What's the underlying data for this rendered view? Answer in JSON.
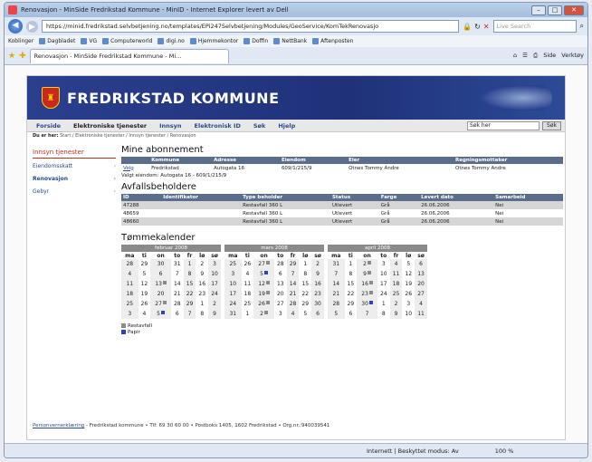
{
  "browser": {
    "window_title": "Renovasjon - MinSide Fredrikstad Kommune - MinID - Internet Explorer levert av Dell",
    "url": "https://minid.fredrikstad.selvbetjening.no/templates/EPi247Selvbetjening/Modules/GeoService/KomTekRenovasjo",
    "search_placeholder": "Live Search",
    "links_label": "Koblinger",
    "favorites": [
      "Dagbladet",
      "VG",
      "Computerworld",
      "digi.no",
      "Hjemmekontor",
      "Doffin",
      "NettBank",
      "Aftenposten"
    ],
    "tab_title": "Renovasjon - MinSide Fredrikstad Kommune - Mi...",
    "tools": [
      "Side",
      "Verktøy"
    ],
    "status_zone": "Internett | Beskyttet modus: Av",
    "zoom": "100 %"
  },
  "site": {
    "title": "FREDRIKSTAD KOMMUNE",
    "nav": [
      "Forside",
      "Elektroniske tjenester",
      "Innsyn",
      "Elektronisk ID",
      "Søk",
      "Hjelp"
    ],
    "search_value": "Søk her",
    "search_button": "Søk",
    "breadcrumb_label": "Du er her:",
    "breadcrumb": "Start / Elektroniske tjenester / Innsyn tjenester / Renovasjon"
  },
  "leftnav": {
    "heading": "Innsyn tjenester",
    "items": [
      "Eiendomsskatt",
      "Renovasjon",
      "Gebyr"
    ]
  },
  "abonnement": {
    "title": "Mine abonnement",
    "headers": [
      "",
      "Kommune",
      "Adresse",
      "Eiendom",
      "Eier",
      "Regningsmottaker"
    ],
    "row": [
      "Velg",
      "Fredrikstad",
      "Autogata 16",
      "609/1/215/9",
      "Otnes Tommy Andre",
      "Otnes Tommy Andre"
    ],
    "selected": "Valgt eiendom: Autogata 16 - 609/1/215/9"
  },
  "avfall": {
    "title": "Avfallsbeholdere",
    "headers": [
      "ID",
      "Identifikator",
      "Type beholder",
      "Status",
      "Farge",
      "Levert dato",
      "Samarbeid"
    ],
    "rows": [
      [
        "47288",
        "",
        "Restavfall 360 L",
        "Utlevert",
        "Grå",
        "26.06.2006",
        "Nei"
      ],
      [
        "48659",
        "",
        "Restavfall 360 L",
        "Utlevert",
        "Grå",
        "26.06.2006",
        "Nei"
      ],
      [
        "48660",
        "",
        "Restavfall 360 L",
        "Utlevert",
        "Grå",
        "26.06.2006",
        "Nei"
      ]
    ]
  },
  "calendar": {
    "title": "Tømmekalender",
    "weekdays": [
      "ma",
      "ti",
      "on",
      "to",
      "fr",
      "lø",
      "sø"
    ],
    "months": [
      {
        "name": "februar 2008",
        "weeks": [
          [
            "28",
            "29",
            "30",
            "31",
            "1",
            "2",
            "3"
          ],
          [
            "4",
            "5",
            "6",
            "7",
            "8",
            "9",
            "10"
          ],
          [
            "11",
            "12",
            "13",
            "14",
            "15",
            "16",
            "17"
          ],
          [
            "18",
            "19",
            "20",
            "21",
            "22",
            "23",
            "24"
          ],
          [
            "25",
            "26",
            "27",
            "28",
            "29",
            "1",
            "2"
          ],
          [
            "3",
            "4",
            "5",
            "6",
            "7",
            "8",
            "9"
          ]
        ],
        "rest": [
          [
            2,
            2
          ],
          [
            4,
            2
          ]
        ],
        "papir": [
          [
            5,
            2
          ]
        ]
      },
      {
        "name": "mars 2008",
        "weeks": [
          [
            "25",
            "26",
            "27",
            "28",
            "29",
            "1",
            "2"
          ],
          [
            "3",
            "4",
            "5",
            "6",
            "7",
            "8",
            "9"
          ],
          [
            "10",
            "11",
            "12",
            "13",
            "14",
            "15",
            "16"
          ],
          [
            "17",
            "18",
            "19",
            "20",
            "21",
            "22",
            "23"
          ],
          [
            "24",
            "25",
            "26",
            "27",
            "28",
            "29",
            "30"
          ],
          [
            "31",
            "1",
            "2",
            "3",
            "4",
            "5",
            "6"
          ]
        ],
        "rest": [
          [
            0,
            2
          ],
          [
            2,
            2
          ],
          [
            3,
            2
          ],
          [
            4,
            2
          ],
          [
            5,
            2
          ]
        ],
        "papir": [
          [
            1,
            2
          ]
        ]
      },
      {
        "name": "april 2008",
        "weeks": [
          [
            "31",
            "1",
            "2",
            "3",
            "4",
            "5",
            "6"
          ],
          [
            "7",
            "8",
            "9",
            "10",
            "11",
            "12",
            "13"
          ],
          [
            "14",
            "15",
            "16",
            "17",
            "18",
            "19",
            "20"
          ],
          [
            "21",
            "22",
            "23",
            "24",
            "25",
            "26",
            "27"
          ],
          [
            "28",
            "29",
            "30",
            "1",
            "2",
            "3",
            "4"
          ],
          [
            "5",
            "6",
            "7",
            "8",
            "9",
            "10",
            "11"
          ]
        ],
        "rest": [
          [
            0,
            2
          ],
          [
            1,
            2
          ],
          [
            2,
            2
          ],
          [
            3,
            2
          ]
        ],
        "papir": [
          [
            4,
            2
          ]
        ]
      }
    ],
    "legend": [
      "Restavfall",
      "Papir"
    ],
    "colors": {
      "rest": "#8a8a8a",
      "papir": "#2b45b8"
    }
  },
  "footer": {
    "link": "Personvernerklæring",
    "text": " - Fredrikstad kommune • Tlf: 69 30 60 00 • Postboks 1405, 1602 Fredrikstad • Org.nr.:940039541"
  }
}
